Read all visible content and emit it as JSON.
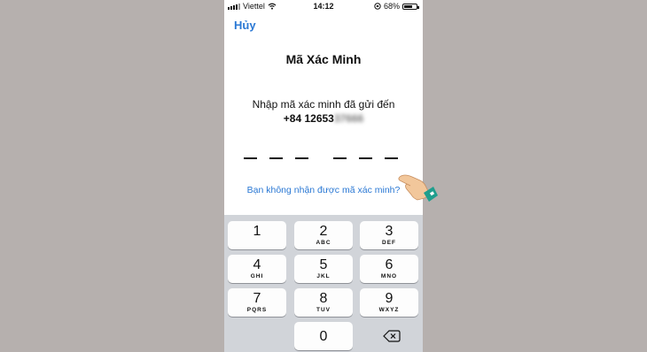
{
  "status_bar": {
    "carrier": "Viettel",
    "time": "14:12",
    "battery": "68%",
    "battery_level": 0.68
  },
  "header": {
    "cancel_label": "Hủy",
    "title": "Mã Xác Minh"
  },
  "main": {
    "instruction": "Nhập mã xác minh đã gửi đến",
    "phone_visible": "+84 12653",
    "phone_blurred": "37666",
    "code_digits": [
      "",
      "",
      "",
      "",
      "",
      ""
    ],
    "resend_link": "Bạn không nhận được mã xác minh?"
  },
  "keypad": {
    "keys": [
      {
        "number": "1",
        "letters": ""
      },
      {
        "number": "2",
        "letters": "ABC"
      },
      {
        "number": "3",
        "letters": "DEF"
      },
      {
        "number": "4",
        "letters": "GHI"
      },
      {
        "number": "5",
        "letters": "JKL"
      },
      {
        "number": "6",
        "letters": "MNO"
      },
      {
        "number": "7",
        "letters": "PQRS"
      },
      {
        "number": "8",
        "letters": "TUV"
      },
      {
        "number": "9",
        "letters": "WXYZ"
      },
      {
        "number": "0",
        "letters": ""
      }
    ]
  },
  "colors": {
    "accent": "#2a78d4",
    "keyboard_bg": "#d1d4d9",
    "page_bg": "#b6b0ae"
  }
}
